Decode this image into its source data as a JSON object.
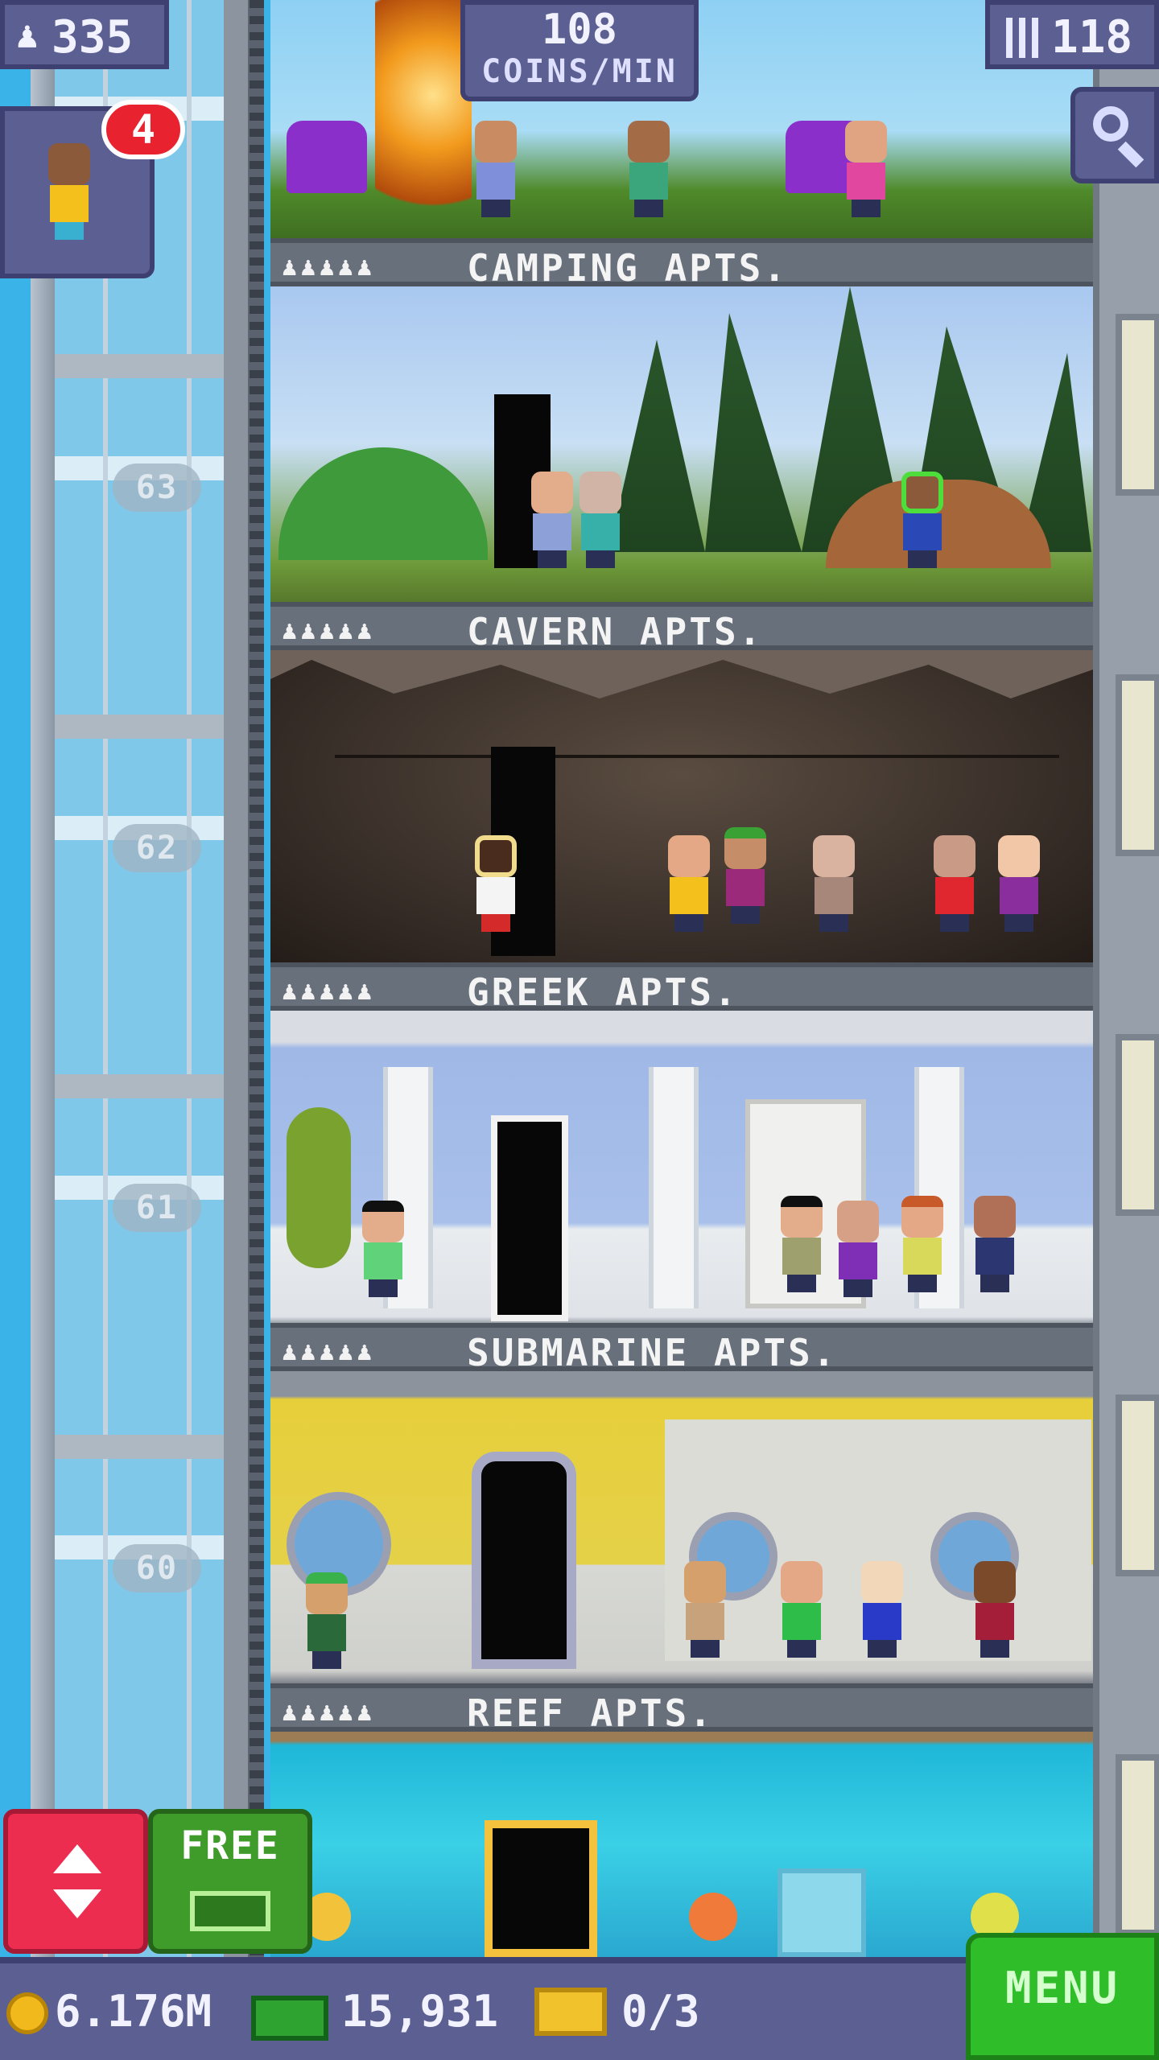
{
  "hud": {
    "population": "335",
    "coins_per_min_value": "108",
    "coins_per_min_unit": "COINS/MIN",
    "floor_count": "118",
    "mission_badge": "4"
  },
  "shaft_floor_numbers": [
    "63",
    "62",
    "61",
    "60"
  ],
  "floors": [
    {
      "name": "CAMPING APTS.",
      "stars": "♟♟♟♟♟"
    },
    {
      "name": "CAVERN APTS.",
      "stars": "♟♟♟♟♟"
    },
    {
      "name": "GREEK APTS.",
      "stars": "♟♟♟♟♟"
    },
    {
      "name": "SUBMARINE APTS.",
      "stars": "♟♟♟♟♟"
    },
    {
      "name": "REEF APTS.",
      "stars": "♟♟♟♟♟"
    }
  ],
  "buttons": {
    "free_label": "FREE",
    "menu_label": "MENU"
  },
  "bottom_bar": {
    "coins": "6.176M",
    "bux": "15,931",
    "tickets": "0/3"
  },
  "icons": {
    "population": "person-icon",
    "floors": "building-icon",
    "search": "magnifier-icon",
    "elevator": "up-down-arrows-icon",
    "bux": "bux-bill-icon",
    "coins": "coin-icon",
    "tickets": "golden-ticket-icon"
  }
}
